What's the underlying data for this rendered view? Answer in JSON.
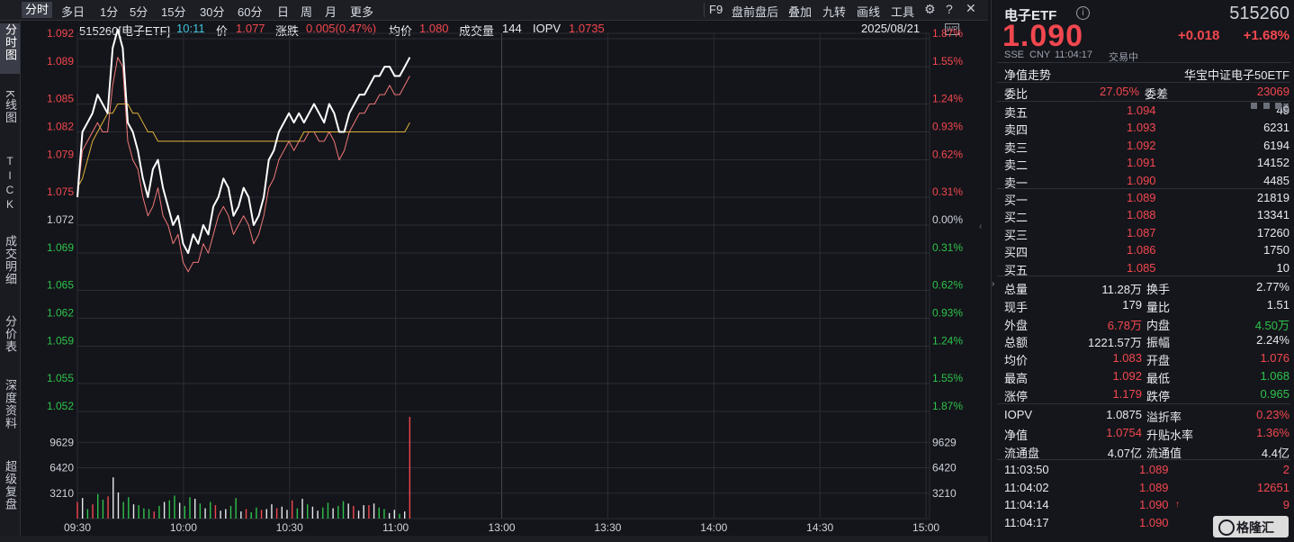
{
  "toolbar": {
    "tabs": [
      "分时",
      "多日",
      "1分",
      "5分",
      "15分",
      "30分",
      "60分",
      "日",
      "周",
      "月",
      "更多"
    ],
    "right_items": [
      "F9",
      "盘前盘后",
      "叠加",
      "九转",
      "画线",
      "工具"
    ]
  },
  "leftnav": {
    "items": [
      "分时图",
      "K线图",
      "TICK",
      "成交明细",
      "分价表",
      "深度资料",
      "超级复盘"
    ]
  },
  "info": {
    "code_name": "515260[电子ETF]",
    "time": "10:11",
    "price_label": "价",
    "price": "1.077",
    "change_label": "涨跌",
    "change": "0.005(0.47%)",
    "avg_label": "均价",
    "avg": "1.080",
    "vol_label": "成交量",
    "vol": "144",
    "iopv_label": "IOPV",
    "iopv": "1.0735",
    "date": "2025/08/21"
  },
  "axes": {
    "price_ticks": [
      "1.092",
      "1.089",
      "1.085",
      "1.082",
      "1.079",
      "1.075",
      "1.072",
      "1.069",
      "1.065",
      "1.062",
      "1.059",
      "1.055",
      "1.052"
    ],
    "pct_ticks": [
      "1.87%",
      "1.55%",
      "1.24%",
      "0.93%",
      "0.62%",
      "0.31%",
      "0.00%",
      "0.31%",
      "0.62%",
      "0.93%",
      "1.24%",
      "1.55%",
      "1.87%"
    ],
    "vol_ticks": [
      "9629",
      "6420",
      "3210"
    ],
    "time_ticks": [
      "09:30",
      "10:00",
      "10:30",
      "11:00",
      "13:00",
      "13:30",
      "14:00",
      "14:30",
      "15:00"
    ]
  },
  "colors": {
    "up": "#f2474f",
    "down": "#2ec24b",
    "price_line": "#ffffff",
    "avg_line": "#e0b23a",
    "iopv_line": "#f07878"
  },
  "chart_data": {
    "type": "line",
    "x_label": "",
    "y_label": "",
    "ylim": [
      1.052,
      1.092
    ],
    "prev_close": 1.072,
    "series": [
      {
        "values": [
          1.075,
          1.082,
          1.083,
          1.084,
          1.086,
          1.085,
          1.084,
          1.091,
          1.093,
          1.091,
          1.083,
          1.082,
          1.08,
          1.077,
          1.075,
          1.078,
          1.079,
          1.076,
          1.074,
          1.072,
          1.073,
          1.07,
          1.069,
          1.071,
          1.07,
          1.072,
          1.071,
          1.074,
          1.075,
          1.077,
          1.076,
          1.073,
          1.074,
          1.076,
          1.075,
          1.072,
          1.073,
          1.075,
          1.079,
          1.08,
          1.082,
          1.083,
          1.084,
          1.083,
          1.084,
          1.083,
          1.084,
          1.085,
          1.084,
          1.083,
          1.085,
          1.084,
          1.082,
          1.082,
          1.084,
          1.085,
          1.086,
          1.086,
          1.087,
          1.088,
          1.088,
          1.089,
          1.089,
          1.088,
          1.088,
          1.089,
          1.09
        ]
      },
      {
        "values": [
          1.076,
          1.077,
          1.079,
          1.081,
          1.082,
          1.083,
          1.084,
          1.084,
          1.085,
          1.085,
          1.085,
          1.084,
          1.084,
          1.083,
          1.082,
          1.082,
          1.081,
          1.081,
          1.081,
          1.081,
          1.081,
          1.081,
          1.081,
          1.081,
          1.081,
          1.081,
          1.081,
          1.081,
          1.081,
          1.081,
          1.081,
          1.081,
          1.081,
          1.081,
          1.081,
          1.081,
          1.081,
          1.081,
          1.081,
          1.081,
          1.081,
          1.081,
          1.081,
          1.081,
          1.081,
          1.082,
          1.082,
          1.082,
          1.082,
          1.082,
          1.082,
          1.082,
          1.082,
          1.082,
          1.082,
          1.082,
          1.082,
          1.082,
          1.082,
          1.082,
          1.082,
          1.082,
          1.082,
          1.082,
          1.082,
          1.082,
          1.083
        ]
      },
      {
        "values": [
          1.075,
          1.08,
          1.081,
          1.082,
          1.083,
          1.082,
          1.082,
          1.087,
          1.09,
          1.089,
          1.081,
          1.079,
          1.078,
          1.075,
          1.073,
          1.074,
          1.076,
          1.073,
          1.072,
          1.07,
          1.071,
          1.068,
          1.067,
          1.068,
          1.068,
          1.07,
          1.069,
          1.071,
          1.073,
          1.074,
          1.073,
          1.071,
          1.072,
          1.073,
          1.072,
          1.07,
          1.071,
          1.073,
          1.076,
          1.077,
          1.079,
          1.08,
          1.081,
          1.08,
          1.081,
          1.081,
          1.082,
          1.082,
          1.081,
          1.081,
          1.082,
          1.081,
          1.079,
          1.08,
          1.082,
          1.083,
          1.084,
          1.084,
          1.085,
          1.085,
          1.086,
          1.086,
          1.087,
          1.086,
          1.086,
          1.087,
          1.088
        ]
      }
    ],
    "volume": {
      "ylim": [
        0,
        12840
      ],
      "values": [
        2100,
        2600,
        1200,
        1800,
        3100,
        2400,
        2800,
        5200,
        3300,
        2100,
        2700,
        1800,
        1700,
        1300,
        1200,
        900,
        1600,
        2100,
        2300,
        2900,
        2000,
        1600,
        2700,
        2500,
        1900,
        1300,
        2100,
        1700,
        1000,
        1200,
        1600,
        2600,
        900,
        1200,
        800,
        1400,
        1100,
        1200,
        1800,
        1300,
        1500,
        1100,
        2300,
        1300,
        2500,
        1800,
        1500,
        1000,
        1400,
        2000,
        1300,
        1600,
        2200,
        1900,
        1600,
        1000,
        1700,
        1700,
        1900,
        1400,
        1200,
        700,
        1100,
        600,
        900,
        12840
      ],
      "up": [
        1,
        1,
        0,
        1,
        0,
        0,
        1,
        1,
        1,
        0,
        0,
        1,
        0,
        0,
        0,
        1,
        0,
        1,
        0,
        0,
        1,
        0,
        0,
        1,
        0,
        1,
        0,
        1,
        1,
        1,
        0,
        0,
        1,
        1,
        0,
        0,
        1,
        1,
        1,
        1,
        1,
        1,
        1,
        0,
        1,
        0,
        1,
        1,
        0,
        0,
        1,
        0,
        0,
        1,
        1,
        1,
        1,
        1,
        1,
        0,
        0,
        1,
        1,
        0,
        1,
        1
      ]
    }
  },
  "right": {
    "title": "电子ETF",
    "code": "515260",
    "price": "1.090",
    "change": "+0.018",
    "change_pct": "+1.68%",
    "sub": [
      "SSE",
      "CNY",
      "11:04:17",
      "交易中"
    ],
    "nav_trend": "净值走势",
    "index_name": "华宝中证电子50ETF",
    "weibi_label": "委比",
    "weibi": "27.05%",
    "weicha_label": "委差",
    "weicha": "23069",
    "tong": "通",
    "asks": [
      {
        "label": "卖五",
        "price": "1.094",
        "vol": "49"
      },
      {
        "label": "卖四",
        "price": "1.093",
        "vol": "6231"
      },
      {
        "label": "卖三",
        "price": "1.092",
        "vol": "6194"
      },
      {
        "label": "卖二",
        "price": "1.091",
        "vol": "14152"
      },
      {
        "label": "卖一",
        "price": "1.090",
        "vol": "4485"
      }
    ],
    "bids": [
      {
        "label": "买一",
        "price": "1.089",
        "vol": "21819"
      },
      {
        "label": "买二",
        "price": "1.088",
        "vol": "13341"
      },
      {
        "label": "买三",
        "price": "1.087",
        "vol": "17260"
      },
      {
        "label": "买四",
        "price": "1.086",
        "vol": "1750"
      },
      {
        "label": "买五",
        "price": "1.085",
        "vol": "10"
      }
    ],
    "stats": [
      {
        "l1": "总量",
        "v1": "11.28万",
        "c1": "white",
        "l2": "换手",
        "v2": "2.77%",
        "c2": "white"
      },
      {
        "l1": "现手",
        "v1": "179",
        "c1": "white",
        "l2": "量比",
        "v2": "1.51",
        "c2": "white"
      },
      {
        "l1": "外盘",
        "v1": "6.78万",
        "c1": "red",
        "l2": "内盘",
        "v2": "4.50万",
        "c2": "green"
      },
      {
        "l1": "总额",
        "v1": "1221.57万",
        "c1": "white",
        "l2": "振幅",
        "v2": "2.24%",
        "c2": "white"
      },
      {
        "l1": "均价",
        "v1": "1.083",
        "c1": "red",
        "l2": "开盘",
        "v2": "1.076",
        "c2": "red"
      },
      {
        "l1": "最高",
        "v1": "1.092",
        "c1": "red",
        "l2": "最低",
        "v2": "1.068",
        "c2": "green"
      },
      {
        "l1": "涨停",
        "v1": "1.179",
        "c1": "red",
        "l2": "跌停",
        "v2": "0.965",
        "c2": "green"
      }
    ],
    "stats2": [
      {
        "l1": "IOPV",
        "v1": "1.0875",
        "c1": "white",
        "l2": "溢折率",
        "v2": "0.23%",
        "c2": "red"
      },
      {
        "l1": "净值",
        "v1": "1.0754",
        "c1": "red",
        "l2": "升贴水率",
        "v2": "1.36%",
        "c2": "red"
      },
      {
        "l1": "流通盘",
        "v1": "4.07亿",
        "c1": "white",
        "l2": "流通值",
        "v2": "4.4亿",
        "c2": "white"
      }
    ],
    "ticks": [
      {
        "time": "11:03:50",
        "price": "1.089",
        "vol": "2",
        "vc": "red"
      },
      {
        "time": "11:04:02",
        "price": "1.089",
        "vol": "12651",
        "vc": "red"
      },
      {
        "time": "11:04:14",
        "price": "1.090",
        "vol": "9",
        "vc": "red",
        "arrow": "↑"
      },
      {
        "time": "11:04:17",
        "price": "1.090",
        "vol": "",
        "vc": "red"
      }
    ],
    "watermark": "格隆汇"
  }
}
